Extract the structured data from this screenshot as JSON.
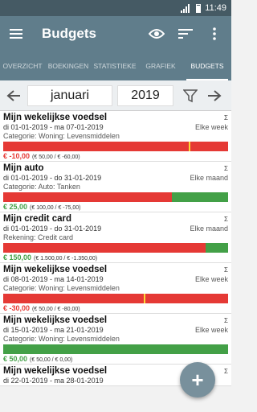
{
  "status": {
    "time": "11:49"
  },
  "toolbar": {
    "title": "Budgets"
  },
  "tabs": [
    {
      "label": "OVERZICHT",
      "active": false
    },
    {
      "label": "BOEKINGEN",
      "active": false
    },
    {
      "label": "STATISTIEKE",
      "active": false
    },
    {
      "label": "GRAFIEK",
      "active": false
    },
    {
      "label": "BUDGETS",
      "active": true
    }
  ],
  "datebar": {
    "month": "januari",
    "year": "2019"
  },
  "items": [
    {
      "name": "Mijn wekelijkse voedsel",
      "sigma": "Σ",
      "period": "di 01-01-2019 - ma 07-01-2019",
      "frequency": "Elke week",
      "category": "Categorie: Woning: Levensmiddelen",
      "progress_red": 100,
      "progress_green": 0,
      "marker": 82.6,
      "amount": "€ -10,00",
      "amount_sign": "neg",
      "detail": "(€ 50,00 / € -60,00)"
    },
    {
      "name": "Mijn auto",
      "sigma": "Σ",
      "period": "di 01-01-2019 - do 31-01-2019",
      "frequency": "Elke maand",
      "category": "Categorie: Auto: Tanken",
      "progress_red": 75,
      "progress_green": 25,
      "marker": null,
      "amount": "€ 25,00",
      "amount_sign": "pos",
      "detail": "(€ 100,00 / € -75,00)"
    },
    {
      "name": "Mijn credit card",
      "sigma": "Σ",
      "period": "di 01-01-2019 - do 31-01-2019",
      "frequency": "Elke maand",
      "category": "Rekening: Credit card",
      "progress_red": 90,
      "progress_green": 10,
      "marker": null,
      "amount": "€ 150,00",
      "amount_sign": "pos",
      "detail": "(€ 1.500,00 / € -1.350,00)"
    },
    {
      "name": "Mijn wekelijkse voedsel",
      "sigma": "Σ",
      "period": "di 08-01-2019 - ma 14-01-2019",
      "frequency": "Elke week",
      "category": "Categorie: Woning: Levensmiddelen",
      "progress_red": 100,
      "progress_green": 0,
      "marker": 62.5,
      "amount": "€ -30,00",
      "amount_sign": "neg",
      "detail": "(€ 50,00 / € -80,00)"
    },
    {
      "name": "Mijn wekelijkse voedsel",
      "sigma": "Σ",
      "period": "di 15-01-2019 - ma 21-01-2019",
      "frequency": "Elke week",
      "category": "Categorie: Woning: Levensmiddelen",
      "progress_red": 0,
      "progress_green": 100,
      "marker": null,
      "amount": "€ 50,00",
      "amount_sign": "pos",
      "detail": "(€ 50,00 / € 0,00)"
    },
    {
      "name": "Mijn wekelijkse voedsel",
      "sigma": "Σ",
      "period": "di 22-01-2019 - ma 28-01-2019",
      "frequency": "",
      "category": "",
      "progress_red": 0,
      "progress_green": 0,
      "marker": null,
      "amount": "",
      "amount_sign": "pos",
      "detail": ""
    }
  ],
  "fab": {
    "label": "+"
  },
  "colors": {
    "primary": "#607d8b",
    "dark": "#455a64",
    "over": "#e53935",
    "under": "#43a047",
    "marker": "#fdd835"
  }
}
